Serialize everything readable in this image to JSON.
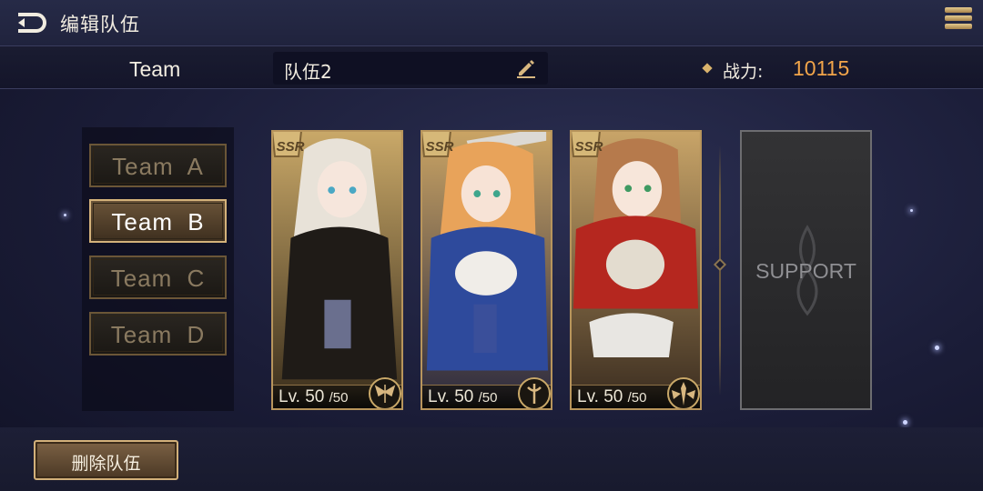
{
  "header": {
    "title": "编辑队伍",
    "back_icon": "back-arrow-icon",
    "menu_icon": "hamburger-menu-icon"
  },
  "info": {
    "team_label": "Team",
    "team_name": "队伍2",
    "power_label": "战力:",
    "power_value": "10115"
  },
  "teams": [
    {
      "label": "Team A",
      "active": false
    },
    {
      "label": "Team B",
      "active": true
    },
    {
      "label": "Team C",
      "active": false
    },
    {
      "label": "Team D",
      "active": false
    }
  ],
  "heroes": [
    {
      "rarity": "SSR",
      "level": "Lv. 50",
      "max_level": "/50",
      "class_icon": "winged-crest-icon"
    },
    {
      "rarity": "SSR",
      "level": "Lv. 50",
      "max_level": "/50",
      "class_icon": "staff-crest-icon"
    },
    {
      "rarity": "SSR",
      "level": "Lv. 50",
      "max_level": "/50",
      "class_icon": "spear-wings-icon"
    }
  ],
  "support": {
    "label": "SUPPORT"
  },
  "footer": {
    "delete_label": "删除队伍"
  },
  "colors": {
    "accent_gold": "#d4b27a",
    "power_orange": "#f2a54a",
    "background": "#1b1d38"
  }
}
